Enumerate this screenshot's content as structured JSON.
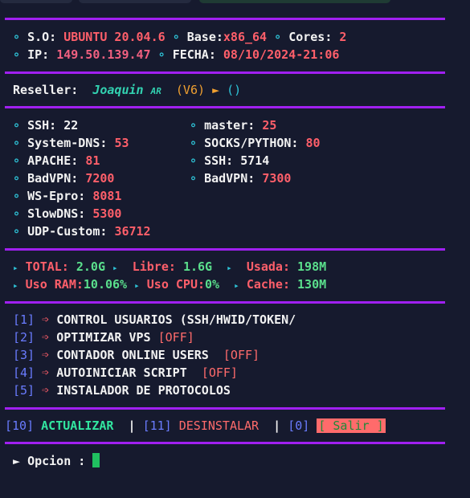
{
  "sysinfo": {
    "so_label": "S.O:",
    "so_value": "UBUNTU 20.04.6",
    "base_label": "Base:",
    "base_value": "x86_64",
    "cores_label": "Cores:",
    "cores_value": "2",
    "ip_label": "IP:",
    "ip_value": "149.50.139.47",
    "fecha_label": "FECHA:",
    "fecha_value": "08/10/2024-21:06"
  },
  "reseller": {
    "label": "Reseller:",
    "name": "Joaquin",
    "flag": "AR",
    "version": "(V6)",
    "play": "►",
    "parens": "()"
  },
  "ports_left": [
    {
      "label": "SSH:",
      "value": "22"
    },
    {
      "label": "System-DNS:",
      "value": "53"
    },
    {
      "label": "APACHE:",
      "value": "81"
    },
    {
      "label": "BadVPN:",
      "value": "7200"
    },
    {
      "label": "WS-Epro:",
      "value": "8081"
    },
    {
      "label": "SlowDNS:",
      "value": "5300"
    },
    {
      "label": "UDP-Custom:",
      "value": "36712"
    }
  ],
  "ports_right": [
    {
      "label": "master:",
      "value": "25"
    },
    {
      "label": "SOCKS/PYTHON:",
      "value": "80"
    },
    {
      "label": "SSH:",
      "value": "5714"
    },
    {
      "label": "BadVPN:",
      "value": "7300"
    }
  ],
  "resources": {
    "total_label": "TOTAL:",
    "total_value": "2.0G",
    "libre_label": "Libre:",
    "libre_value": "1.6G",
    "usada_label": "Usada:",
    "usada_value": "198M",
    "ram_label": "Uso RAM:",
    "ram_value": "10.06%",
    "cpu_label": "Uso CPU:",
    "cpu_value": "0%",
    "cache_label": "Cache:",
    "cache_value": "130M"
  },
  "menu": [
    {
      "num": "[1]",
      "label": "CONTROL USUARIOS (SSH/HWID/TOKEN/",
      "status": ""
    },
    {
      "num": "[2]",
      "label": "OPTIMIZAR VPS",
      "status": "[OFF]"
    },
    {
      "num": "[3]",
      "label": "CONTADOR ONLINE USERS",
      "status": "[OFF]"
    },
    {
      "num": "[4]",
      "label": "AUTOINICIAR SCRIPT",
      "status": "[OFF]"
    },
    {
      "num": "[5]",
      "label": "INSTALADOR DE PROTOCOLOS",
      "status": ""
    }
  ],
  "bottom": {
    "n10": "[10]",
    "actualizar": "ACTUALIZAR",
    "sep": "|",
    "n11": "[11]",
    "desinstalar": "DESINSTALAR",
    "n0": "[0]",
    "salir": "[ Salir ]"
  },
  "prompt": {
    "arrow": "►",
    "label": "Opcion :"
  }
}
